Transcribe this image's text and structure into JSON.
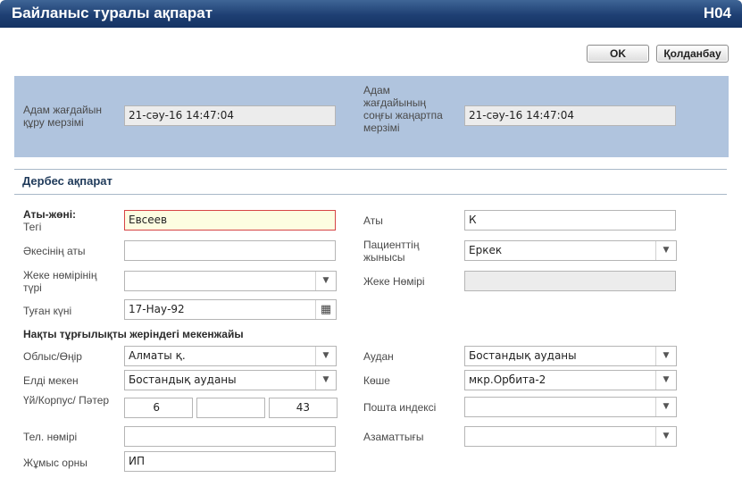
{
  "window": {
    "title": "Байланыс туралы ақпарат",
    "code": "H04"
  },
  "toolbar": {
    "ok_label": "OK",
    "apply_label": "Қолданбау"
  },
  "audit": {
    "created_label": "Адам жағдайын құру мерзімі",
    "created_value": "21-сәу-16 14:47:04",
    "updated_label": "Адам жағдайының соңғы жаңартпа мерзімі",
    "updated_value": "21-сәу-16 14:47:04"
  },
  "personal": {
    "section_title": "Дербес ақпарат",
    "fullname_label": "Аты-жөні:",
    "surname_label": "Тегі",
    "surname_value": "Евсеев",
    "firstname_label": "Аты",
    "firstname_value": "К",
    "patronymic_label": "Әкесінің аты",
    "patronymic_value": "",
    "gender_label": "Пациенттің жынысы",
    "gender_value": "Еркек",
    "idtype_label": "Жеке нөмірінің түрі",
    "idtype_value": "",
    "idnumber_label": "Жеке Нөмірі",
    "idnumber_value": "",
    "birthdate_label": "Туған күні",
    "birthdate_value": "17-Нау-92"
  },
  "address": {
    "section_title": "Нақты тұрғылықты жеріндегі мекенжайы",
    "region_label": "Облыс/Өңір",
    "region_value": "Алматы қ.",
    "district_label": "Аудан",
    "district_value": "Бостандық ауданы",
    "locality_label": "Елді мекен",
    "locality_value": "Бостандық ауданы",
    "street_label": "Көше",
    "street_value": "мкр.Орбита-2",
    "house_label": "Үй/Корпус/ Пәтер",
    "house_value": "6",
    "building_value": "",
    "apartment_value": "43",
    "postcode_label": "Пошта индексі",
    "postcode_value": "",
    "phone_label": "Тел. нөмірі",
    "phone_value": "",
    "citizenship_label": "Азаматтығы",
    "citizenship_value": "",
    "workplace_label": "Жұмыс орны",
    "workplace_value": "ИП"
  },
  "icons": {
    "dropdown": "chevron-down-icon",
    "calendar": "calendar-icon"
  }
}
